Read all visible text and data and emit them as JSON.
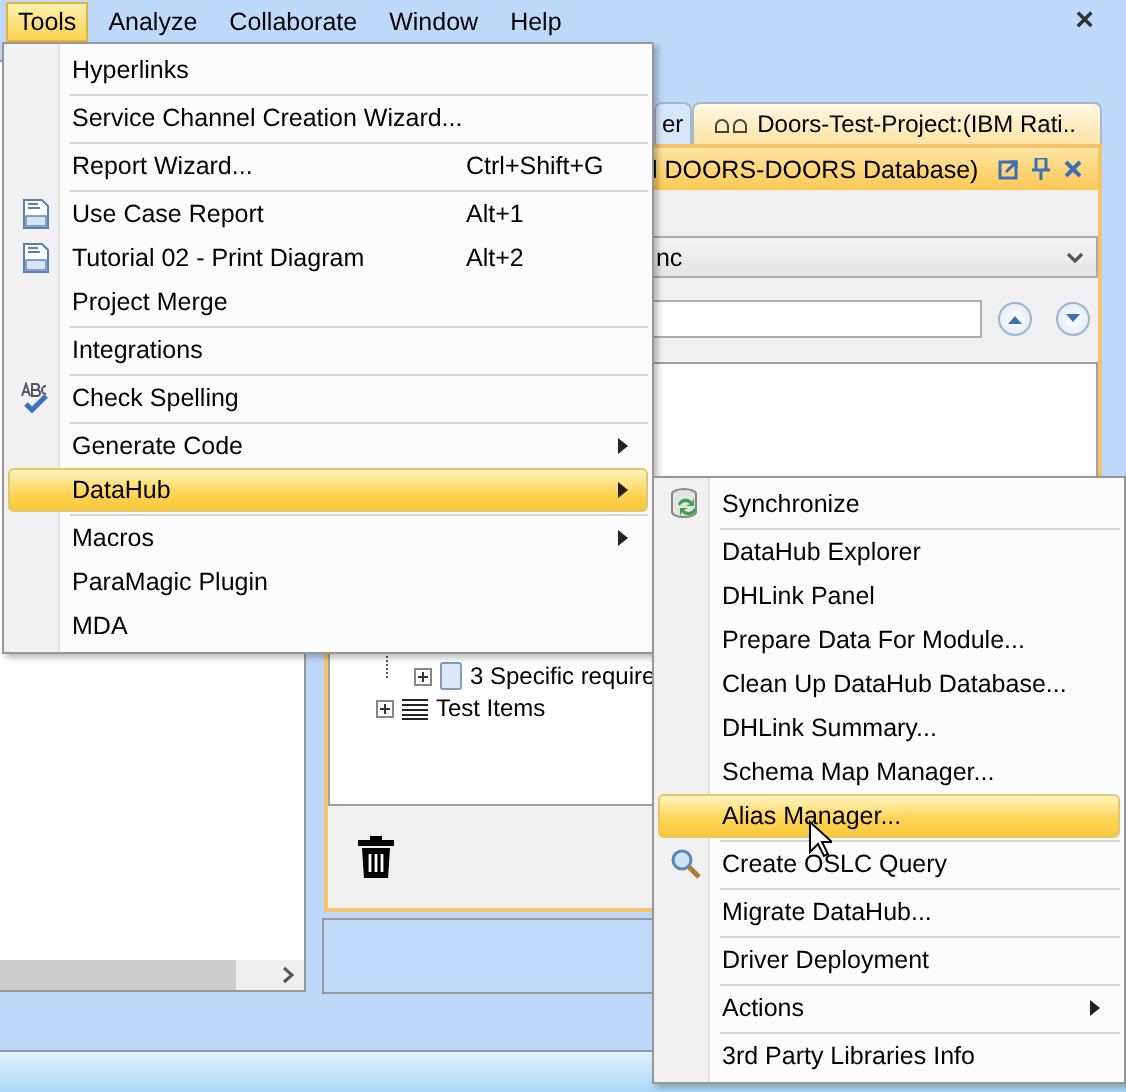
{
  "menubar": {
    "items": [
      {
        "label": "Tools",
        "selected": true
      },
      {
        "label": "Analyze",
        "selected": false
      },
      {
        "label": "Collaborate",
        "selected": false
      },
      {
        "label": "Window",
        "selected": false
      },
      {
        "label": "Help",
        "selected": false
      }
    ],
    "close": "×"
  },
  "tabs": [
    {
      "label": "er",
      "selected": false
    },
    {
      "label": "Doors-Test-Project:(IBM Rati..",
      "selected": true
    }
  ],
  "panel": {
    "title": "l DOORS-DOORS Database)",
    "combo_value": "nc",
    "tree": [
      {
        "label": "3 Specific require",
        "kind": "document"
      },
      {
        "label": "Test Items",
        "kind": "list"
      }
    ]
  },
  "tools_menu": {
    "groups": [
      [
        {
          "label": "Hyperlinks",
          "kind": "plain",
          "submenu": false,
          "selected": false
        }
      ],
      [
        {
          "label": "Service Channel Creation Wizard...",
          "kind": "plain",
          "submenu": false,
          "selected": false
        }
      ],
      [
        {
          "label": "Report Wizard...",
          "shortcut": "Ctrl+Shift+G",
          "kind": "plain",
          "submenu": false,
          "selected": false
        }
      ],
      [
        {
          "label": "Use Case Report",
          "shortcut": "Alt+1",
          "kind": "report",
          "submenu": false,
          "selected": false
        },
        {
          "label": "Tutorial 02 - Print Diagram",
          "shortcut": "Alt+2",
          "kind": "report",
          "submenu": false,
          "selected": false
        },
        {
          "label": "Project Merge",
          "kind": "plain",
          "submenu": false,
          "selected": false
        }
      ],
      [
        {
          "label": "Integrations",
          "kind": "plain",
          "submenu": false,
          "selected": false
        }
      ],
      [
        {
          "label": "Check Spelling",
          "kind": "spelling",
          "submenu": false,
          "selected": false
        }
      ],
      [
        {
          "label": "Generate Code",
          "kind": "plain",
          "submenu": true,
          "selected": false
        },
        {
          "label": "DataHub",
          "kind": "plain",
          "submenu": true,
          "selected": true
        }
      ],
      [
        {
          "label": "Macros",
          "kind": "plain",
          "submenu": true,
          "selected": false
        },
        {
          "label": "ParaMagic Plugin",
          "kind": "plain",
          "submenu": false,
          "selected": false
        },
        {
          "label": "MDA",
          "kind": "plain",
          "submenu": false,
          "selected": false
        }
      ]
    ]
  },
  "datahub_menu": {
    "groups": [
      [
        {
          "label": "Synchronize",
          "kind": "sync",
          "submenu": false,
          "selected": false
        }
      ],
      [
        {
          "label": "DataHub Explorer",
          "kind": "plain",
          "submenu": false,
          "selected": false
        },
        {
          "label": "DHLink Panel",
          "kind": "plain",
          "submenu": false,
          "selected": false
        },
        {
          "label": "Prepare Data For Module...",
          "kind": "plain",
          "submenu": false,
          "selected": false
        },
        {
          "label": "Clean Up DataHub Database...",
          "kind": "plain",
          "submenu": false,
          "selected": false
        },
        {
          "label": "DHLink Summary...",
          "kind": "plain",
          "submenu": false,
          "selected": false
        },
        {
          "label": "Schema Map Manager...",
          "kind": "plain",
          "submenu": false,
          "selected": false
        },
        {
          "label": "Alias Manager...",
          "kind": "plain",
          "submenu": false,
          "selected": true
        }
      ],
      [
        {
          "label": "Create OSLC Query",
          "kind": "search",
          "submenu": false,
          "selected": false
        }
      ],
      [
        {
          "label": "Migrate DataHub...",
          "kind": "plain",
          "submenu": false,
          "selected": false
        }
      ],
      [
        {
          "label": "Driver Deployment",
          "kind": "plain",
          "submenu": false,
          "selected": false
        }
      ],
      [
        {
          "label": "Actions",
          "kind": "plain",
          "submenu": true,
          "selected": false
        }
      ],
      [
        {
          "label": "3rd Party Libraries Info",
          "kind": "plain",
          "submenu": false,
          "selected": false
        }
      ]
    ]
  }
}
